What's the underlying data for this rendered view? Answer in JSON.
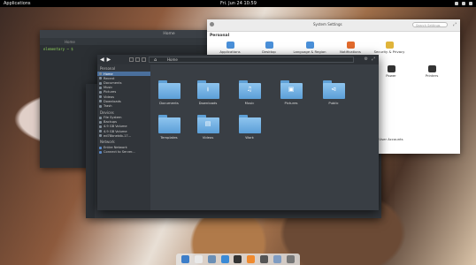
{
  "topbar": {
    "apps": "Applications",
    "clock": "Fri. Jun 24 10:59"
  },
  "terminal": {
    "title": "Home",
    "tab": "Home",
    "prompt": "elementary ~ $"
  },
  "settings": {
    "title": "System Settings",
    "search_placeholder": "Search Settings",
    "section": "Personal",
    "items": [
      {
        "label": "Applications",
        "icon": "applications-icon"
      },
      {
        "label": "Desktop",
        "icon": "desktop-icon"
      },
      {
        "label": "Language & Region",
        "icon": "language-icon"
      },
      {
        "label": "Notifications",
        "icon": "notifications-icon"
      },
      {
        "label": "Security & Privacy",
        "icon": "security-icon"
      }
    ],
    "power": "Power",
    "printers": "Printers",
    "user_accounts": "User Accounts"
  },
  "filemanager": {
    "path": "Home",
    "sidebar": {
      "personal_head": "Personal",
      "personal": [
        "Home",
        "Recent",
        "Documents",
        "Music",
        "Pictures",
        "Videos",
        "Downloads",
        "Trash"
      ],
      "devices_head": "Devices",
      "devices": [
        "File System",
        "Backups",
        "4.9 GB Volume",
        "4.9 GB Volume",
        "ed78bnetdb-17..."
      ],
      "network_head": "Network",
      "network": [
        "Entire Network",
        "Connect to Server..."
      ]
    },
    "folders": [
      {
        "label": "Documents",
        "glyph": "",
        "icon": "folder-documents-icon"
      },
      {
        "label": "Downloads",
        "glyph": "⭳",
        "icon": "folder-downloads-icon"
      },
      {
        "label": "Music",
        "glyph": "♫",
        "icon": "folder-music-icon"
      },
      {
        "label": "Pictures",
        "glyph": "▣",
        "icon": "folder-pictures-icon"
      },
      {
        "label": "Public",
        "glyph": "⊲",
        "icon": "folder-public-icon"
      },
      {
        "label": "Templates",
        "glyph": "",
        "icon": "folder-templates-icon"
      },
      {
        "label": "Videos",
        "glyph": "▤",
        "icon": "folder-videos-icon"
      },
      {
        "label": "Work",
        "glyph": "",
        "icon": "folder-icon"
      }
    ]
  },
  "dock": {
    "icons": [
      {
        "name": "files-icon",
        "color": "#3d7ec9"
      },
      {
        "name": "calendar-icon",
        "color": "#e9e9e9"
      },
      {
        "name": "mail-icon",
        "color": "#6b8fb5"
      },
      {
        "name": "web-browser-icon",
        "color": "#3a8ad6"
      },
      {
        "name": "terminal-icon",
        "color": "#333333"
      },
      {
        "name": "music-icon",
        "color": "#f08a2e"
      },
      {
        "name": "video-icon",
        "color": "#555555"
      },
      {
        "name": "photos-icon",
        "color": "#7f9cc2"
      },
      {
        "name": "settings-icon",
        "color": "#777777"
      }
    ]
  }
}
